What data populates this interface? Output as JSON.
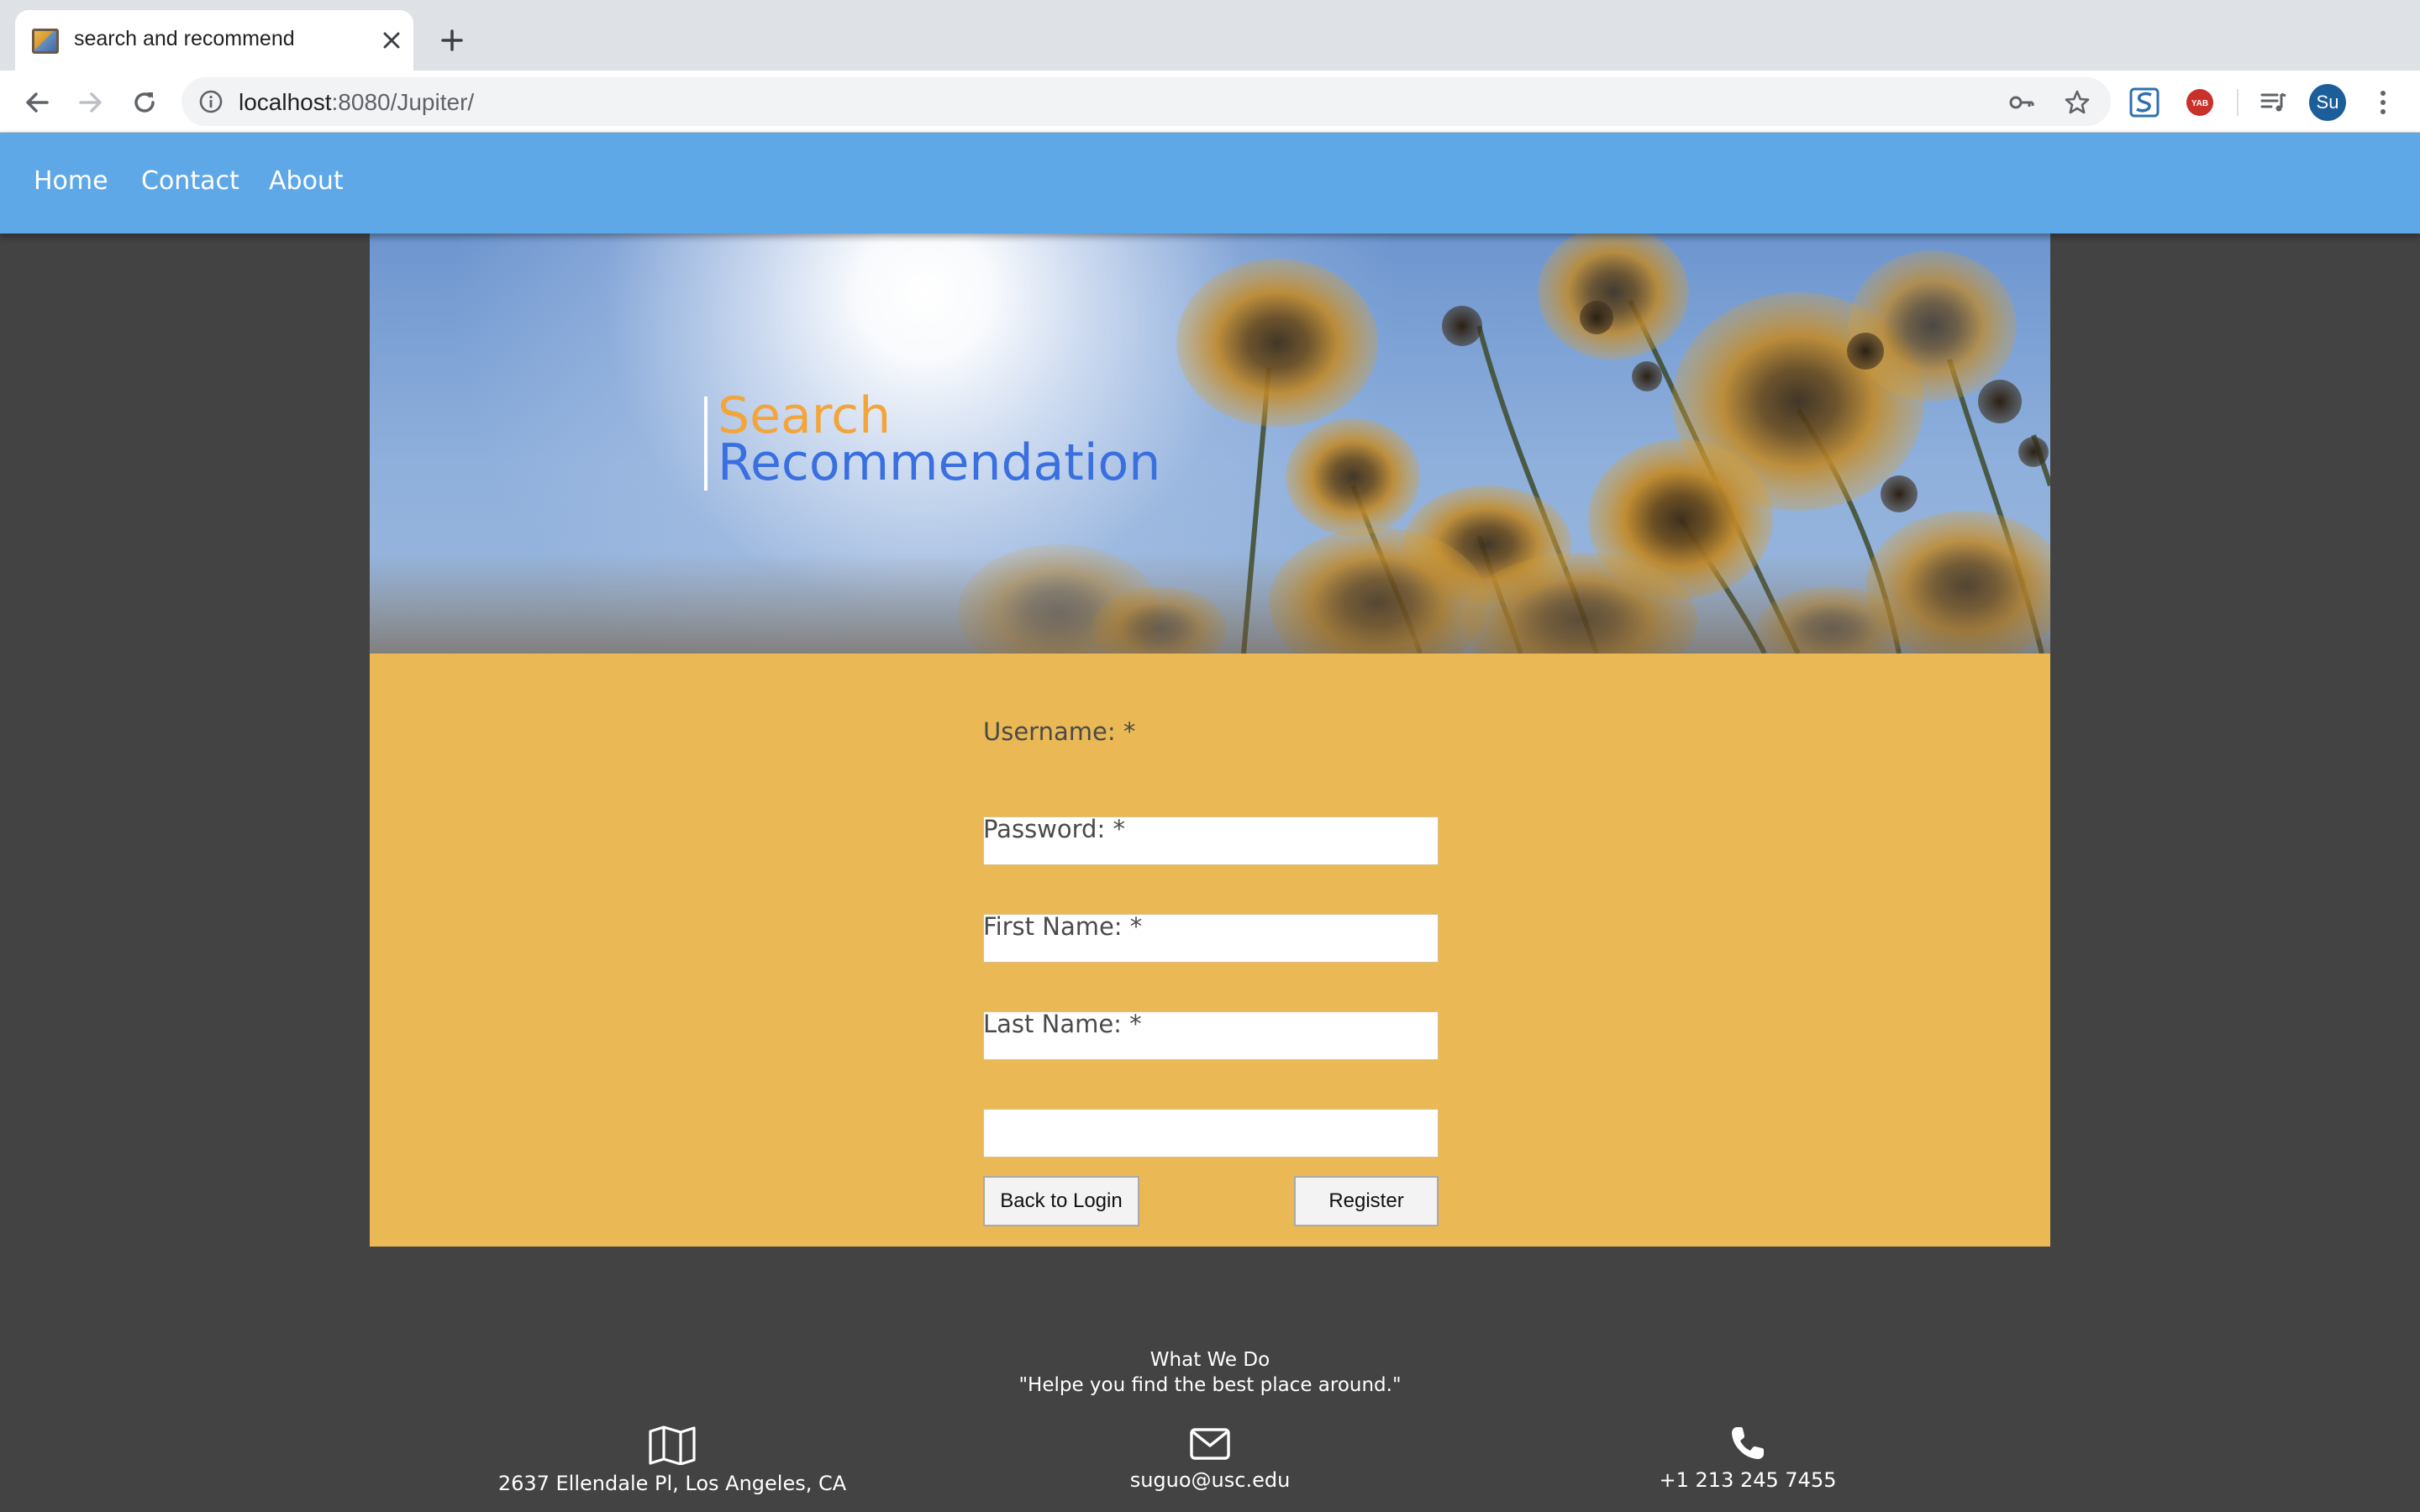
{
  "browser": {
    "tab_title": "search and recommend",
    "url_host": "localhost",
    "url_path": ":8080/Jupiter/",
    "profile_initials": "Su",
    "extensions": [
      "key-icon",
      "bookmark-star-icon",
      "s-extension-icon",
      "yab-extension-icon",
      "media-queue-icon"
    ]
  },
  "nav": {
    "home": "Home",
    "contact": "Contact",
    "about": "About"
  },
  "hero": {
    "title_line1": "Search",
    "title_line2": "Recommendation",
    "title_line1_color": "#f3a53c",
    "title_line2_color": "#3a6fe0"
  },
  "form": {
    "username_label": "Username: *",
    "password_label": "Password: *",
    "first_name_label": "First Name: *",
    "last_name_label": "Last Name: *",
    "username_value": "",
    "password_value": "",
    "first_name_value": "",
    "last_name_value": "",
    "back_label": "Back to Login",
    "register_label": "Register"
  },
  "footer": {
    "heading": "What We Do",
    "tagline": "\"Helpe you find the best place around.\"",
    "address": "2637 Ellendale Pl, Los Angeles, CA",
    "email": "suguo@usc.edu",
    "phone": "+1 213 245 7455"
  },
  "colors": {
    "nav_bg": "#5fa8e8",
    "form_bg": "#eab955",
    "page_bg": "#434343"
  }
}
